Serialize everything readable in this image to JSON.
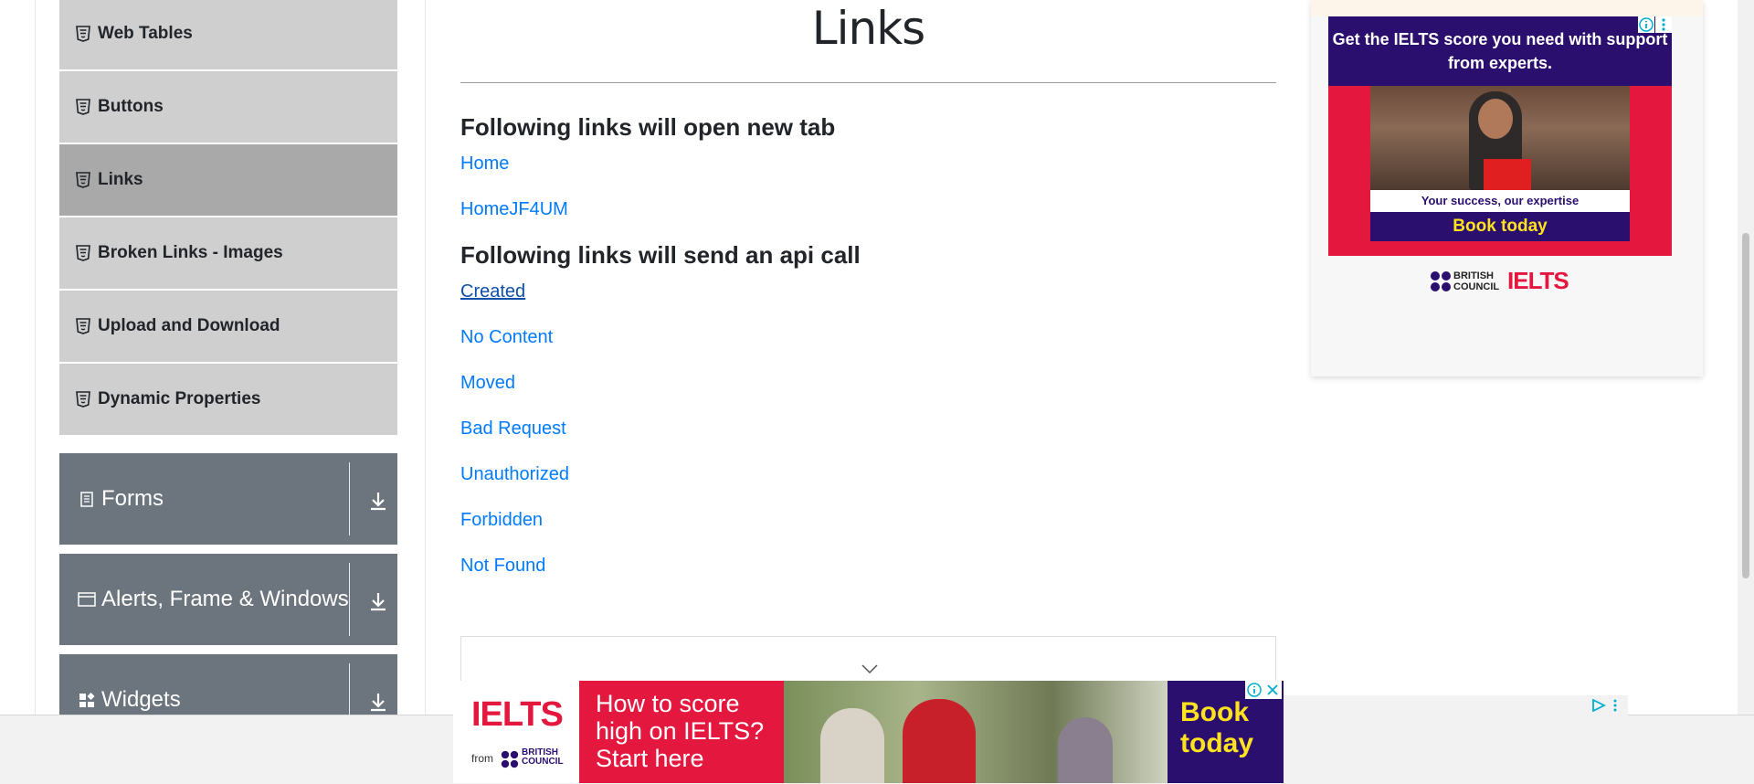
{
  "sidebar": {
    "elements_items": [
      {
        "label": "Web Tables"
      },
      {
        "label": "Buttons"
      },
      {
        "label": "Links"
      },
      {
        "label": "Broken Links - Images"
      },
      {
        "label": "Upload and Download"
      },
      {
        "label": "Dynamic Properties"
      }
    ],
    "active_item": "Links",
    "groups": [
      {
        "label": "Forms"
      },
      {
        "label": "Alerts, Frame & Windows"
      },
      {
        "label": "Widgets"
      }
    ]
  },
  "main": {
    "title": "Links",
    "new_tab_heading": "Following links will open new tab",
    "new_tab_links": [
      "Home",
      "HomeJF4UM"
    ],
    "api_heading": "Following links will send an api call",
    "api_links": [
      "Created",
      "No Content",
      "Moved",
      "Bad Request",
      "Unauthorized",
      "Forbidden",
      "Not Found"
    ]
  },
  "right_ad": {
    "headline": "Get the IELTS score you need with support from experts.",
    "tagline": "Your success, our expertise",
    "cta": "Book today",
    "sponsor_line1": "BRITISH",
    "sponsor_line2": "COUNCIL",
    "brand": "IELTS"
  },
  "banner_ad": {
    "brand": "IELTS",
    "from": "from",
    "sponsor_line1": "BRITISH",
    "sponsor_line2": "COUNCIL",
    "headline_line1": "How to score",
    "headline_line2": "high on IELTS?",
    "headline_line3": "Start here",
    "cta_line1": "Book",
    "cta_line2": "today"
  },
  "colors": {
    "link": "#007bff",
    "sidebar_item_bg": "#cfcfcf",
    "sidebar_active_bg": "#a9a9a9",
    "group_header_bg": "#6c757d",
    "ielts_red": "#e4173e",
    "ielts_purple": "#2a0f6e",
    "cta_yellow": "#ffe21f"
  }
}
